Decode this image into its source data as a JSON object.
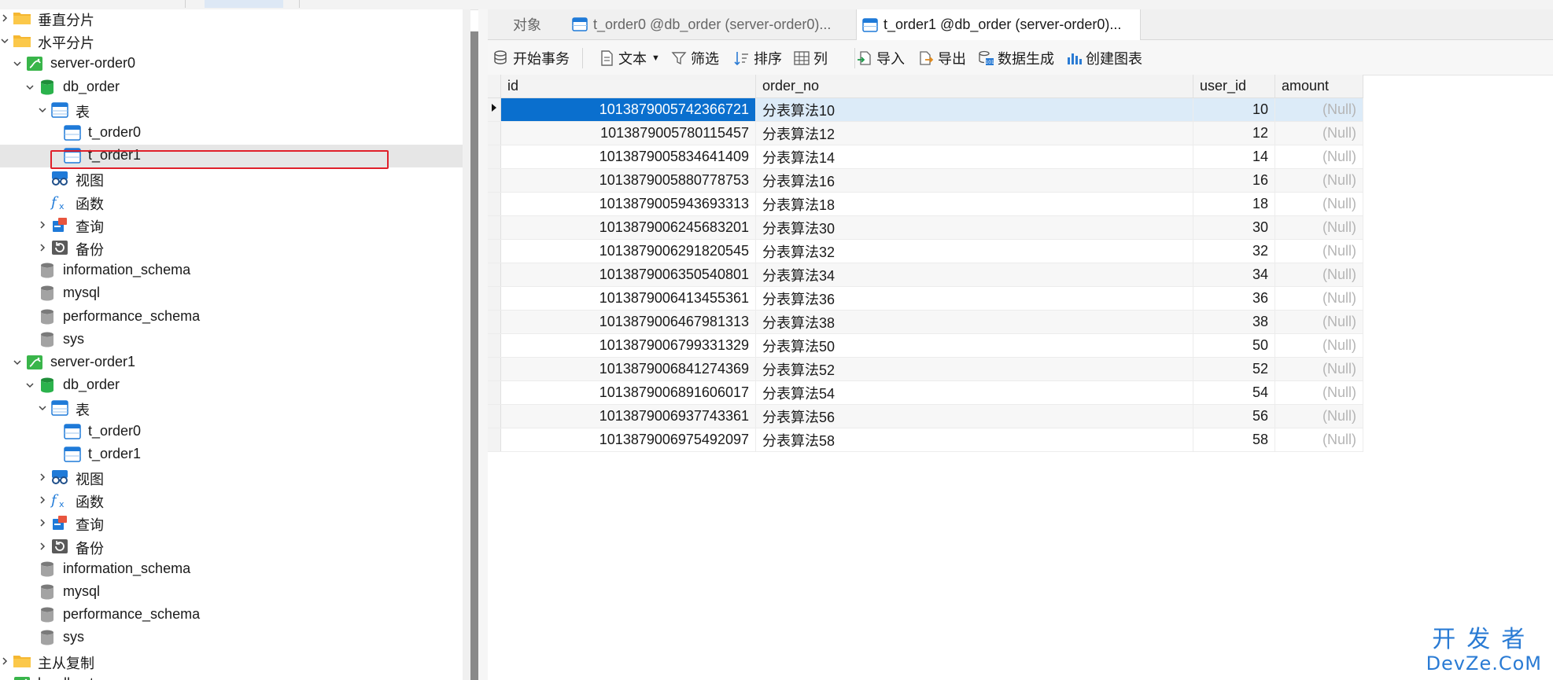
{
  "tree": {
    "items": [
      {
        "label": "垂直分片",
        "icon": "folder-icon",
        "indent": 0,
        "chevron": ">"
      },
      {
        "label": "水平分片",
        "icon": "folder-icon",
        "indent": 0,
        "chevron": "v"
      },
      {
        "label": "server-order0",
        "icon": "server-connection-icon",
        "indent": 1,
        "chevron": "v"
      },
      {
        "label": "db_order",
        "icon": "database-icon",
        "indent": 2,
        "chevron": "v"
      },
      {
        "label": "表",
        "icon": "tables-icon",
        "indent": 3,
        "chevron": "v"
      },
      {
        "label": "t_order0",
        "icon": "table-icon",
        "indent": 4,
        "chevron": ""
      },
      {
        "label": "t_order1",
        "icon": "table-icon",
        "indent": 4,
        "chevron": "",
        "selected": true
      },
      {
        "label": "视图",
        "icon": "views-icon",
        "indent": 3,
        "chevron": ""
      },
      {
        "label": "函数",
        "icon": "function-icon",
        "indent": 3,
        "chevron": ""
      },
      {
        "label": "查询",
        "icon": "query-icon",
        "indent": 3,
        "chevron": ">"
      },
      {
        "label": "备份",
        "icon": "backup-icon",
        "indent": 3,
        "chevron": ">"
      },
      {
        "label": "information_schema",
        "icon": "database-gray-icon",
        "indent": 2,
        "chevron": ""
      },
      {
        "label": "mysql",
        "icon": "database-gray-icon",
        "indent": 2,
        "chevron": ""
      },
      {
        "label": "performance_schema",
        "icon": "database-gray-icon",
        "indent": 2,
        "chevron": ""
      },
      {
        "label": "sys",
        "icon": "database-gray-icon",
        "indent": 2,
        "chevron": ""
      },
      {
        "label": "server-order1",
        "icon": "server-connection-icon",
        "indent": 1,
        "chevron": "v"
      },
      {
        "label": "db_order",
        "icon": "database-icon",
        "indent": 2,
        "chevron": "v"
      },
      {
        "label": "表",
        "icon": "tables-icon",
        "indent": 3,
        "chevron": "v"
      },
      {
        "label": "t_order0",
        "icon": "table-icon",
        "indent": 4,
        "chevron": ""
      },
      {
        "label": "t_order1",
        "icon": "table-icon",
        "indent": 4,
        "chevron": ""
      },
      {
        "label": "视图",
        "icon": "views-icon",
        "indent": 3,
        "chevron": ">"
      },
      {
        "label": "函数",
        "icon": "function-icon",
        "indent": 3,
        "chevron": ">"
      },
      {
        "label": "查询",
        "icon": "query-icon",
        "indent": 3,
        "chevron": ">"
      },
      {
        "label": "备份",
        "icon": "backup-icon",
        "indent": 3,
        "chevron": ">"
      },
      {
        "label": "information_schema",
        "icon": "database-gray-icon",
        "indent": 2,
        "chevron": ""
      },
      {
        "label": "mysql",
        "icon": "database-gray-icon",
        "indent": 2,
        "chevron": ""
      },
      {
        "label": "performance_schema",
        "icon": "database-gray-icon",
        "indent": 2,
        "chevron": ""
      },
      {
        "label": "sys",
        "icon": "database-gray-icon",
        "indent": 2,
        "chevron": ""
      },
      {
        "label": "主从复制",
        "icon": "folder-icon",
        "indent": 0,
        "chevron": ">"
      },
      {
        "label": "localhost",
        "icon": "server-connection-icon",
        "indent": 0,
        "chevron": ""
      }
    ]
  },
  "tabs": [
    {
      "label": "对象",
      "active": false,
      "icon": ""
    },
    {
      "label": "t_order0 @db_order (server-order0)...",
      "active": false,
      "icon": "table-icon"
    },
    {
      "label": "t_order1 @db_order (server-order0)...",
      "active": true,
      "icon": "table-icon"
    }
  ],
  "toolbar": {
    "begin_transaction": "开始事务",
    "text": "文本",
    "filter": "筛选",
    "sort": "排序",
    "columns": "列",
    "import": "导入",
    "export": "导出",
    "data_generation": "数据生成",
    "create_chart": "创建图表"
  },
  "grid": {
    "columns": [
      "id",
      "order_no",
      "user_id",
      "amount"
    ],
    "null_text": "(Null)",
    "rows": [
      {
        "id": "1013879005742366721",
        "order_no": "分表算法10",
        "user_id": "10"
      },
      {
        "id": "1013879005780115457",
        "order_no": "分表算法12",
        "user_id": "12"
      },
      {
        "id": "1013879005834641409",
        "order_no": "分表算法14",
        "user_id": "14"
      },
      {
        "id": "1013879005880778753",
        "order_no": "分表算法16",
        "user_id": "16"
      },
      {
        "id": "1013879005943693313",
        "order_no": "分表算法18",
        "user_id": "18"
      },
      {
        "id": "1013879006245683201",
        "order_no": "分表算法30",
        "user_id": "30"
      },
      {
        "id": "1013879006291820545",
        "order_no": "分表算法32",
        "user_id": "32"
      },
      {
        "id": "1013879006350540801",
        "order_no": "分表算法34",
        "user_id": "34"
      },
      {
        "id": "1013879006413455361",
        "order_no": "分表算法36",
        "user_id": "36"
      },
      {
        "id": "1013879006467981313",
        "order_no": "分表算法38",
        "user_id": "38"
      },
      {
        "id": "1013879006799331329",
        "order_no": "分表算法50",
        "user_id": "50"
      },
      {
        "id": "1013879006841274369",
        "order_no": "分表算法52",
        "user_id": "52"
      },
      {
        "id": "1013879006891606017",
        "order_no": "分表算法54",
        "user_id": "54"
      },
      {
        "id": "1013879006937743361",
        "order_no": "分表算法56",
        "user_id": "56"
      },
      {
        "id": "1013879006975492097",
        "order_no": "分表算法58",
        "user_id": "58"
      }
    ]
  },
  "watermark": {
    "line1": "开发者",
    "line2": "DevZe.CoM"
  },
  "colors": {
    "accent": "#0a6fce",
    "selection": "#dcebf8",
    "null": "#b5b5b5",
    "highlight_box": "#e0202a"
  }
}
